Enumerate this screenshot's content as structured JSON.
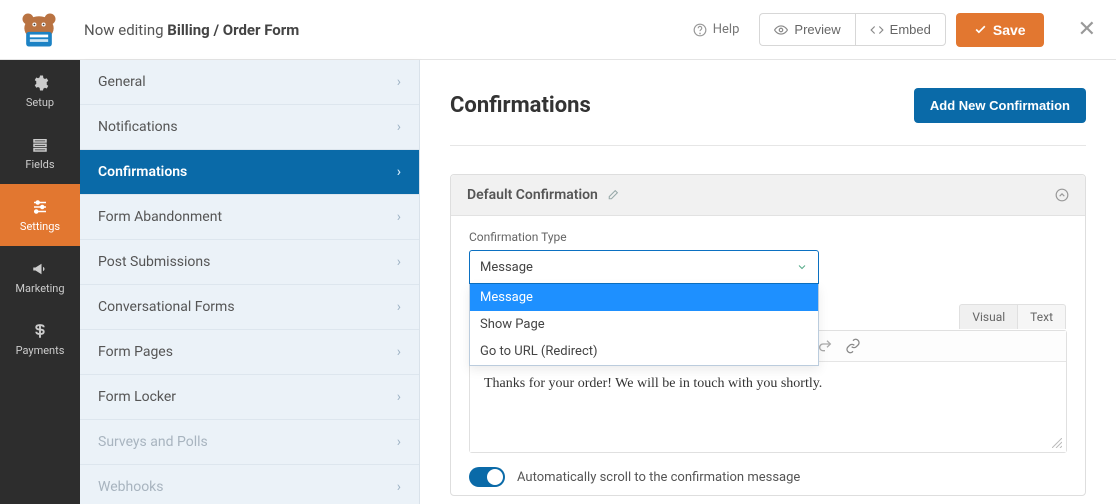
{
  "header": {
    "editing_prefix": "Now editing ",
    "form_name": "Billing / Order Form",
    "help_label": "Help",
    "preview_label": "Preview",
    "embed_label": "Embed",
    "save_label": "Save"
  },
  "rail": [
    {
      "id": "setup",
      "label": "Setup",
      "active": false
    },
    {
      "id": "fields",
      "label": "Fields",
      "active": false
    },
    {
      "id": "settings",
      "label": "Settings",
      "active": true
    },
    {
      "id": "marketing",
      "label": "Marketing",
      "active": false
    },
    {
      "id": "payments",
      "label": "Payments",
      "active": false
    }
  ],
  "submenu": [
    {
      "label": "General",
      "active": false,
      "disabled": false
    },
    {
      "label": "Notifications",
      "active": false,
      "disabled": false
    },
    {
      "label": "Confirmations",
      "active": true,
      "disabled": false
    },
    {
      "label": "Form Abandonment",
      "active": false,
      "disabled": false
    },
    {
      "label": "Post Submissions",
      "active": false,
      "disabled": false
    },
    {
      "label": "Conversational Forms",
      "active": false,
      "disabled": false
    },
    {
      "label": "Form Pages",
      "active": false,
      "disabled": false
    },
    {
      "label": "Form Locker",
      "active": false,
      "disabled": false
    },
    {
      "label": "Surveys and Polls",
      "active": false,
      "disabled": true
    },
    {
      "label": "Webhooks",
      "active": false,
      "disabled": true
    }
  ],
  "main": {
    "title": "Confirmations",
    "add_button_label": "Add New Confirmation",
    "panel_title": "Default Confirmation",
    "confirmation_type_label": "Confirmation Type",
    "type_selected": "Message",
    "type_options": [
      "Message",
      "Show Page",
      "Go to URL (Redirect)"
    ],
    "editor_tabs": [
      "Visual",
      "Text"
    ],
    "message_body": "Thanks for your order! We will be in touch with you shortly.",
    "scroll_toggle_label": "Automatically scroll to the confirmation message",
    "colors": {
      "accent": "#e27730",
      "primary_blue": "#0a6aa8",
      "select_blue": "#0b70c1"
    }
  }
}
